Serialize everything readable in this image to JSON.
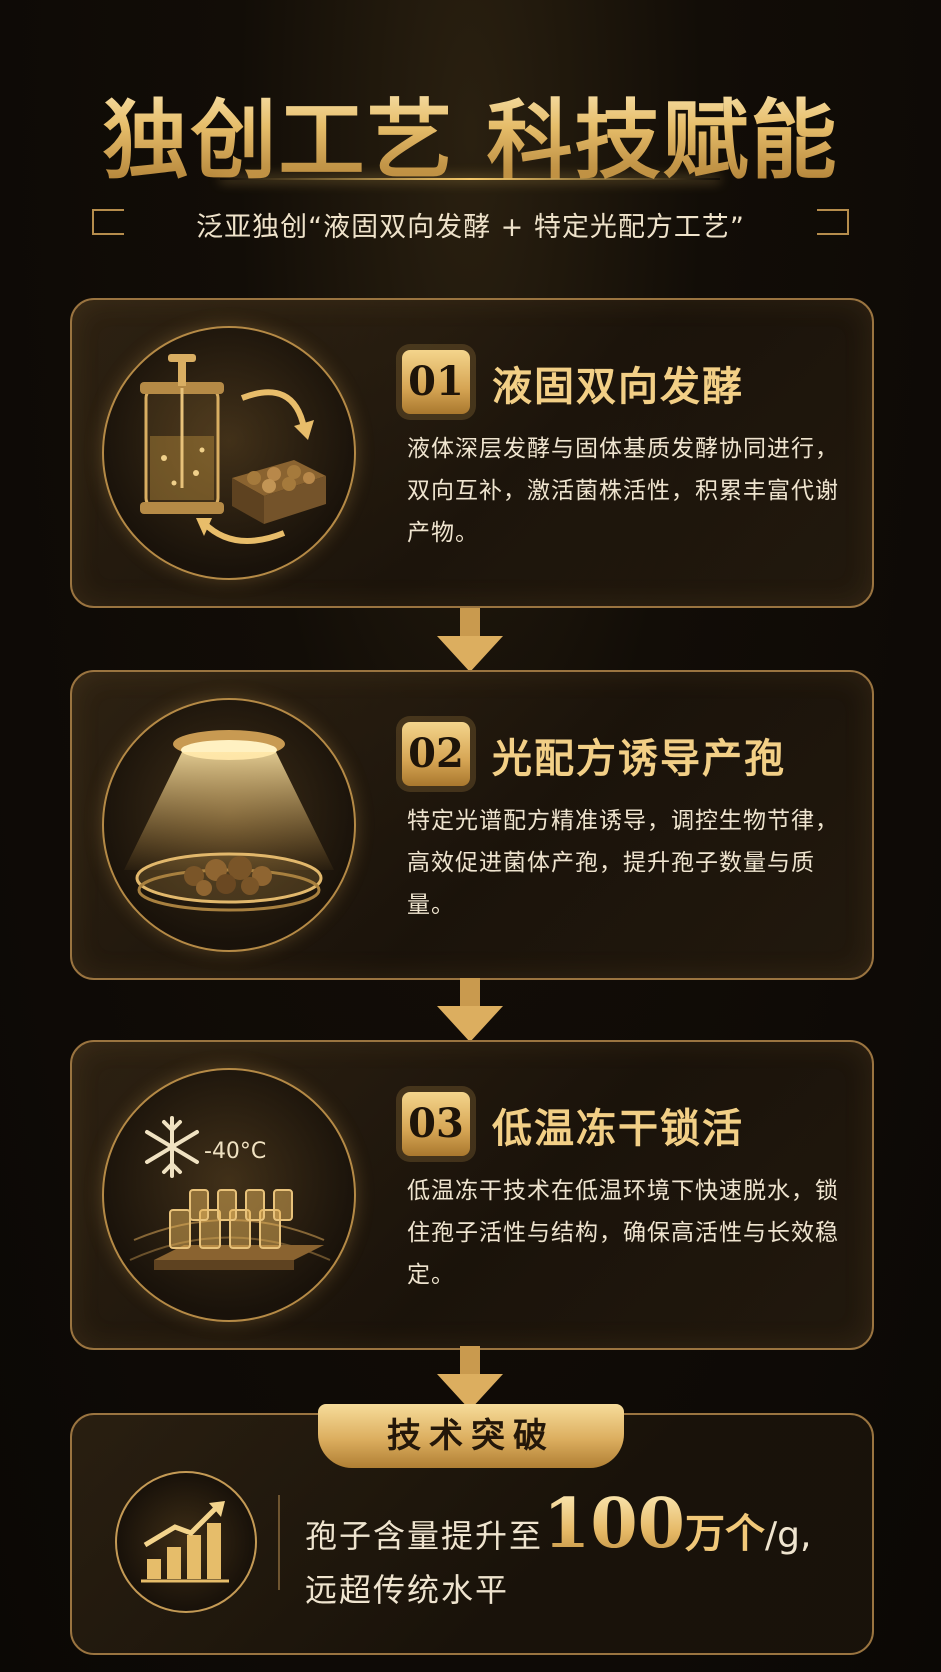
{
  "header": {
    "title": "独创工艺 科技赋能",
    "subtitle": "泛亚独创“液固双向发酵 + 特定光配方工艺”"
  },
  "steps": [
    {
      "num": "01",
      "title": "液固双向发酵",
      "desc": "液体深层发酵与固体基质发酵协同进行，双向互补，激活菌株活性，积累丰富代谢产物。",
      "icon": "fermenter-and-solid-substrate-icon"
    },
    {
      "num": "02",
      "title": "光配方诱导产孢",
      "desc": "特定光谱配方精准诱导，调控生物节律，高效促进菌体产孢，提升孢子数量与质量。",
      "icon": "light-over-petri-dish-icon"
    },
    {
      "num": "03",
      "title": "低温冻干锁活",
      "desc": "低温冻干技术在低温环境下快速脱水，锁住孢子活性与结构，确保高活性与长效稳定。",
      "icon": "freeze-dry-vials-icon",
      "temp_label": "-40°C"
    }
  ],
  "breakthrough": {
    "badge": "技术突破",
    "line1_prefix": "孢子含量提升至",
    "value": "100",
    "unit": "万个",
    "suffix": "/g,",
    "line2": "远超传统水平",
    "icon": "growth-chart-icon"
  },
  "colors": {
    "gold": "#e6bd6a",
    "gold_light": "#f6dc9a",
    "background": "#0b0805",
    "border": "#9a7440",
    "text": "#efe4cf"
  }
}
